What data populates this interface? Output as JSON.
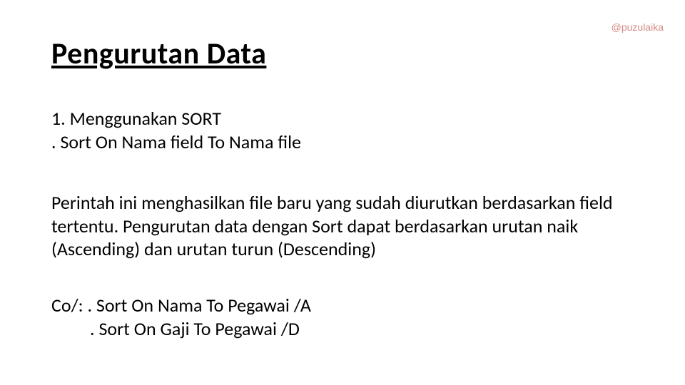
{
  "watermark": "@puzulaika",
  "title": "Pengurutan Data",
  "section1": {
    "line1": "1. Menggunakan SORT",
    "line2": ". Sort On Nama field To Nama file"
  },
  "paragraph": "Perintah ini menghasilkan file baru yang sudah diurutkan berdasarkan field tertentu. Pengurutan data dengan Sort dapat berdasarkan urutan naik (Ascending) dan urutan turun (Descending)",
  "example": {
    "line1": "Co/: . Sort On Nama To Pegawai /A",
    "line2": ". Sort On Gaji To Pegawai /D"
  }
}
